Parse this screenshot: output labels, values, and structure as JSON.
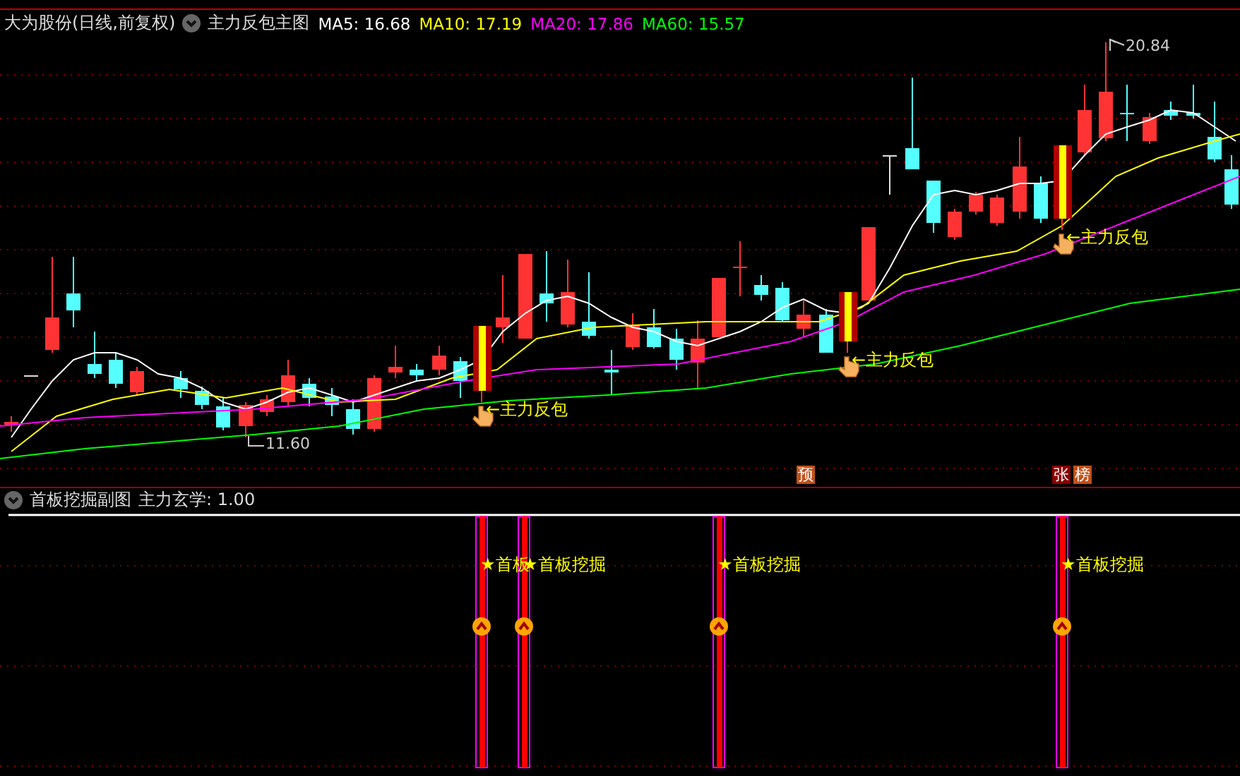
{
  "header": {
    "stock_title": "大为股份(日线,前复权)",
    "indicator_name": "主力反包主图",
    "ma_readings": [
      {
        "label": "MA5: 16.68",
        "color": "#ffffff"
      },
      {
        "label": "MA10: 17.19",
        "color": "#ffff00"
      },
      {
        "label": "MA20: 17.86",
        "color": "#ff00ff"
      },
      {
        "label": "MA60: 15.57",
        "color": "#00ff00"
      }
    ]
  },
  "main_chart": {
    "high_label": "20.84",
    "low_label": "11.60",
    "signals": [
      {
        "text": "←主力反包"
      },
      {
        "text": "←主力反包"
      },
      {
        "text": "←主力反包"
      }
    ],
    "badges": [
      {
        "text": "预",
        "color": "#c0501a"
      },
      {
        "text": "张",
        "color": "#8b0000"
      },
      {
        "text": "榜",
        "color": "#c0501a"
      }
    ]
  },
  "sub_panel": {
    "title": "首板挖掘副图",
    "reading": "主力玄学: 1.00",
    "signals": [
      {
        "text": "★首板"
      },
      {
        "text": "★首板挖掘"
      },
      {
        "text": "★首板挖掘"
      },
      {
        "text": "★首板挖掘"
      }
    ]
  }
}
